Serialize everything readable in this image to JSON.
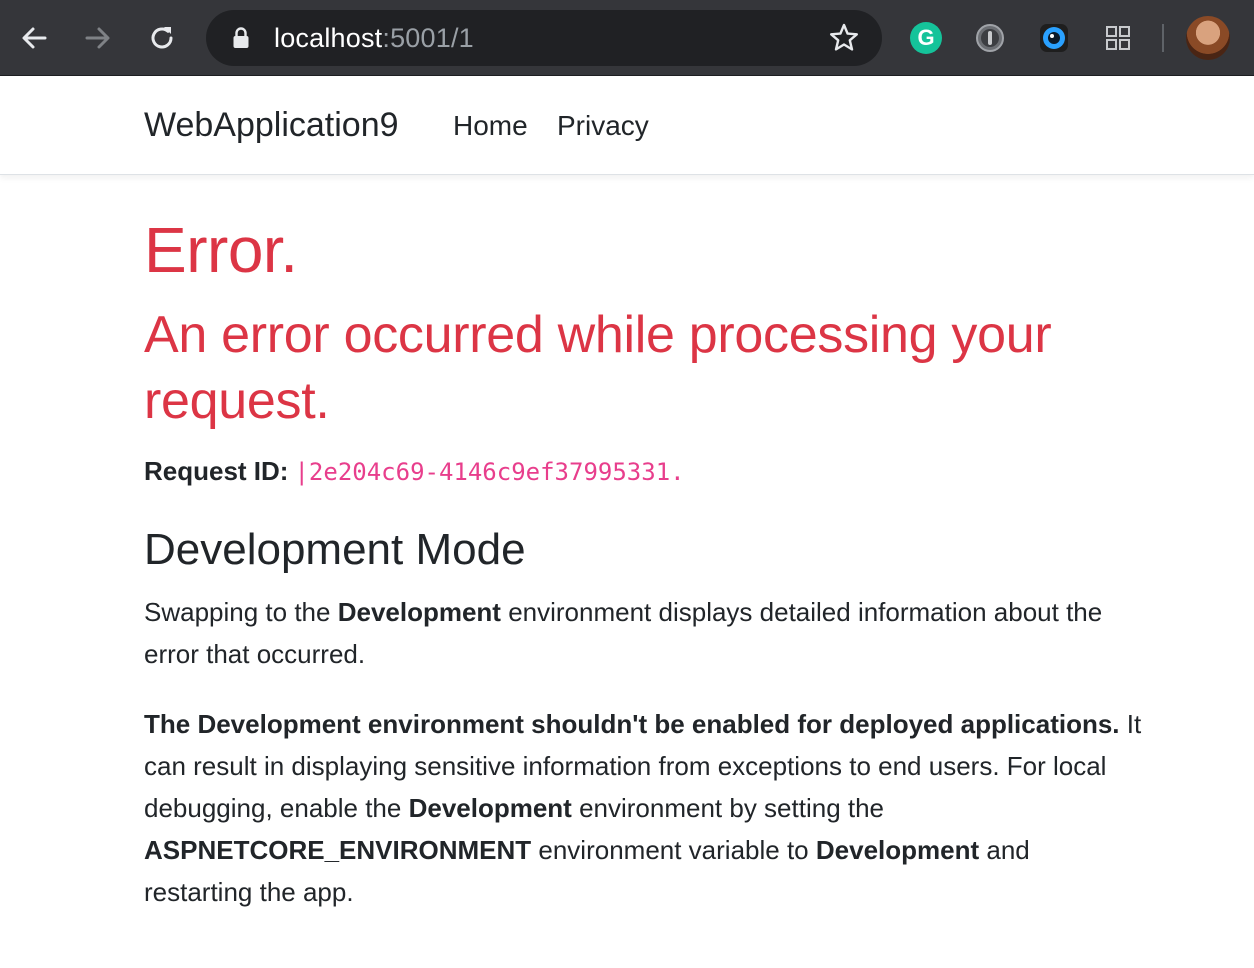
{
  "browser": {
    "url_host": "localhost",
    "url_rest": ":5001/1",
    "extensions": {
      "grammarly_label": "G"
    },
    "icons": [
      "back-arrow-icon",
      "forward-arrow-icon",
      "reload-icon",
      "lock-icon",
      "star-icon",
      "grammarly-icon",
      "1password-icon",
      "lens-extension-icon",
      "apps-grid-icon",
      "profile-avatar"
    ]
  },
  "navbar": {
    "brand": "WebApplication9",
    "links": [
      {
        "label": "Home"
      },
      {
        "label": "Privacy"
      }
    ]
  },
  "main": {
    "title": "Error.",
    "subtitle": "An error occurred while processing your request.",
    "request_id_label": "Request ID:",
    "request_id_value": "|2e204c69-4146c9ef37995331.",
    "dev_heading": "Development Mode",
    "para1": {
      "pre": "Swapping to the ",
      "bold": "Development",
      "post": " environment displays detailed information about the error that occurred."
    },
    "para2": {
      "bold1": "The Development environment shouldn't be enabled for deployed applications.",
      "text1": " It can result in displaying sensitive information from exceptions to end users. For local debugging, enable the ",
      "bold2": "Development",
      "text2": " environment by setting the ",
      "bold3": "ASPNETCORE_ENVIRONMENT",
      "text3": " environment variable to ",
      "bold4": "Development",
      "text4": " and restarting the app."
    }
  },
  "colors": {
    "chrome_bg": "#35363a",
    "omnibox_bg": "#202124",
    "error_red": "#dc3545",
    "code_pink": "#e83e8c",
    "text": "#212529"
  }
}
